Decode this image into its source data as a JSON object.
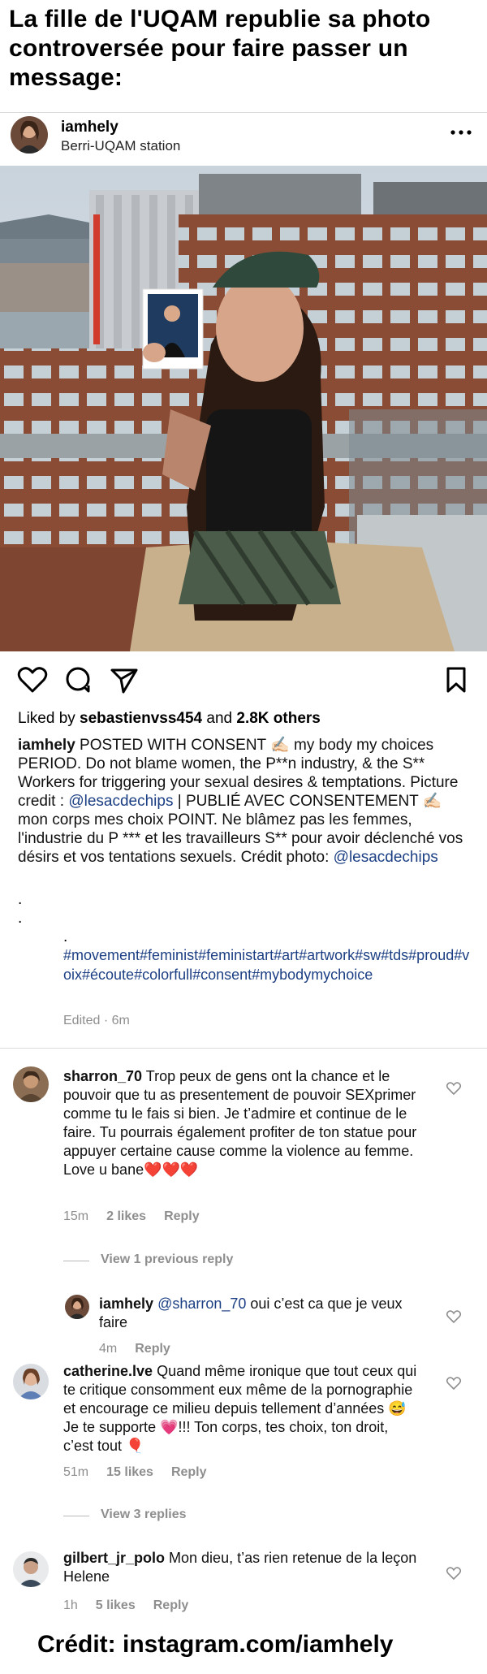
{
  "headline": "La fille de l'UQAM republie sa photo controversée pour faire passer un message:",
  "post": {
    "username": "iamhely",
    "location": "Berri-UQAM station",
    "more_icon": "more-horizontal-icon",
    "likes_prefix": "Liked by ",
    "likes_user": "sebastienvss454",
    "likes_mid": " and ",
    "likes_count": "2.8K others",
    "caption_user": "iamhely",
    "caption_text_1": "POSTED WITH CONSENT ✍🏻 my body my choices PERIOD. Do not blame women, the P**n industry, & the S** Workers for triggering your sexual desires & temptations.  Picture credit : ",
    "caption_mention_1": "@lesacdechips",
    "caption_text_2": " | PUBLIÉ AVEC CONSENTEMENT ✍🏻 mon corps mes choix POINT. Ne blâmez pas les femmes, l'industrie du P *** et les travailleurs S** pour avoir déclenché vos désirs et vos tentations sexuels. Crédit photo: ",
    "caption_mention_2": "@lesacdechips",
    "dots": [
      ".",
      ".",
      "."
    ],
    "hashtags": "#movement#feminist#feministart#art#artwork#sw#tds#proud#voix#écoute#colorfull#consent#mybodymychoice",
    "edited": "Edited · 6m"
  },
  "comments": [
    {
      "user": "sharron_70",
      "text": "Trop peux de gens ont la chance et le pouvoir que tu as presentement de pouvoir SEXprimer comme tu le fais si bien.  Je t’admire et continue de le faire.  Tu pourrais également profiter de ton statue pour appuyer certaine cause comme la violence au femme. Love u bane❤️❤️❤️",
      "time": "15m",
      "likes": "2 likes",
      "reply": "Reply",
      "view_replies": "View 1 previous reply"
    },
    {
      "user": "iamhely",
      "mention": "@sharron_70",
      "text": " oui c’est ca que je veux faire",
      "time": "4m",
      "reply": "Reply"
    },
    {
      "user": "catherine.lve",
      "text": "Quand même ironique que tout ceux qui te critique consomment eux même de la pornographie et encourage ce milieu depuis tellement d’années 😅 Je te supporte 💗!!! Ton corps, tes choix, ton droit, c’est tout 🎈",
      "time": "51m",
      "likes": "15 likes",
      "reply": "Reply",
      "view_replies": "View 3 replies"
    },
    {
      "user": "gilbert_jr_polo",
      "text": "Mon dieu, t’as rien retenue de la leçon Helene",
      "time": "1h",
      "likes": "5 likes",
      "reply": "Reply"
    }
  ],
  "credit": "Crédit: instagram.com/iamhely",
  "icons": [
    "heart-icon",
    "comment-icon",
    "share-icon",
    "bookmark-icon"
  ],
  "colors": {
    "link": "#1c3f84",
    "muted": "#8e8e8e",
    "heart_red": "#d42a2a"
  }
}
